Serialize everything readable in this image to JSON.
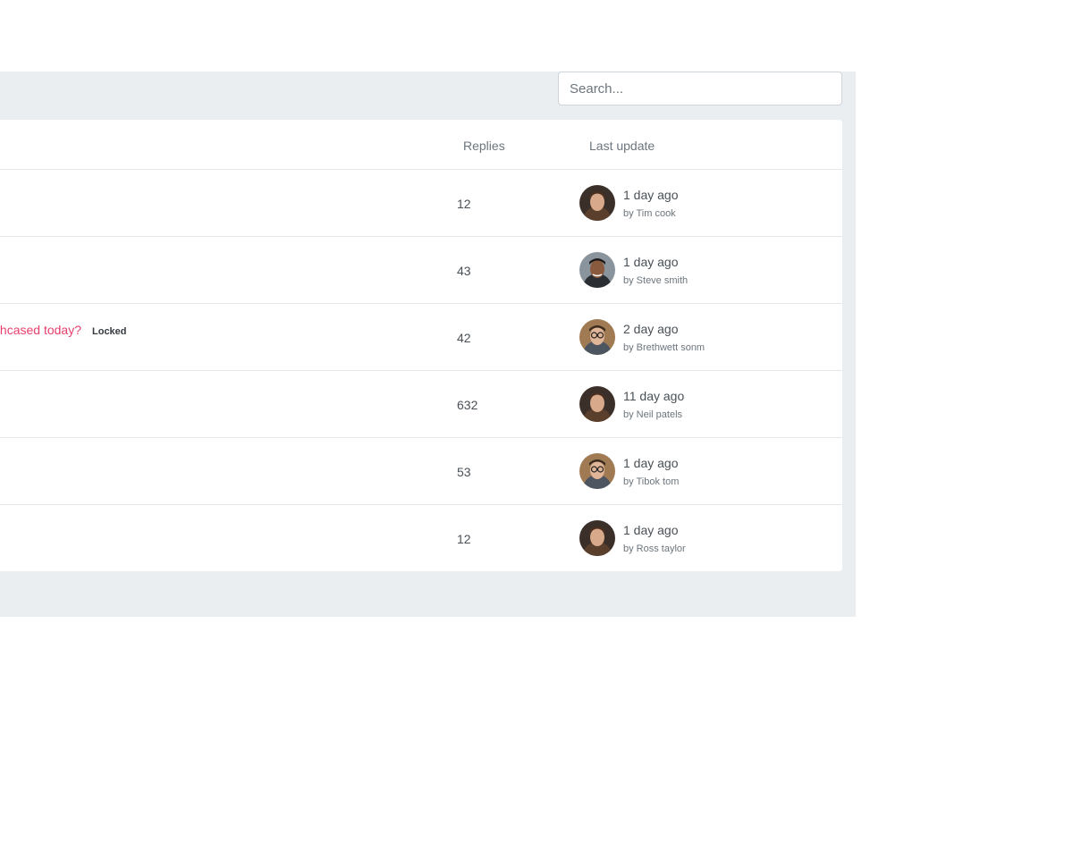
{
  "search": {
    "placeholder": "Search..."
  },
  "table": {
    "headers": {
      "replies": "Replies",
      "last_update": "Last update"
    },
    "rows": [
      {
        "topic": "",
        "badge": "",
        "replies": "12",
        "time": "1 day ago",
        "by": "by Tim cook",
        "avatar": "man-brown-hair"
      },
      {
        "topic": "",
        "badge": "",
        "replies": "43",
        "time": "1 day ago",
        "by": "by Steve smith",
        "avatar": "man-dark-hair"
      },
      {
        "topic": "rhcased today?",
        "badge": "Locked",
        "replies": "42",
        "time": "2 day ago",
        "by": "by Brethwett sonm",
        "avatar": "man-glasses"
      },
      {
        "topic": "",
        "badge": "",
        "replies": "632",
        "time": "11 day ago",
        "by": "by Neil patels",
        "avatar": "man-brown-hair"
      },
      {
        "topic": "",
        "badge": "",
        "replies": "53",
        "time": "1 day ago",
        "by": "by Tibok tom",
        "avatar": "man-glasses"
      },
      {
        "topic": "",
        "badge": "",
        "replies": "12",
        "time": "1 day ago",
        "by": "by Ross taylor",
        "avatar": "man-brown-hair"
      }
    ]
  },
  "colors": {
    "accent": "#e83e6c",
    "panel_bg": "#ebeef1",
    "border": "#e5e7ea"
  }
}
